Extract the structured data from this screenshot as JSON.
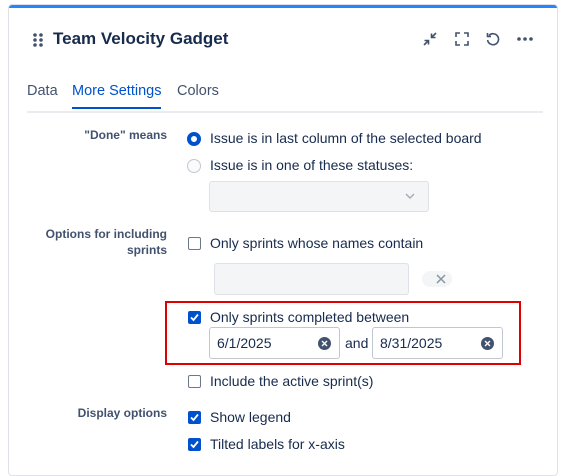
{
  "gadget": {
    "title": "Team Velocity Gadget"
  },
  "header_icons": [
    "drag-handle-icon",
    "minimize-icon",
    "fullscreen-icon",
    "refresh-icon",
    "more-icon"
  ],
  "tabs": [
    {
      "label": "Data",
      "active": false
    },
    {
      "label": "More Settings",
      "active": true
    },
    {
      "label": "Colors",
      "active": false
    }
  ],
  "done_means": {
    "label": "\"Done\" means",
    "options": [
      {
        "label": "Issue is in last column of the selected board",
        "selected": true
      },
      {
        "label": "Issue is in one of these statuses:",
        "selected": false
      }
    ],
    "status_select_value": ""
  },
  "sprints": {
    "label": "Options for including sprints",
    "name_contains": {
      "label": "Only sprints whose names contain",
      "checked": false,
      "value": ""
    },
    "completed_between": {
      "label": "Only sprints completed between",
      "checked": true,
      "start": "6/1/2025",
      "and_label": "and",
      "end": "8/31/2025"
    },
    "include_active": {
      "label": "Include the active sprint(s)",
      "checked": false
    }
  },
  "display": {
    "label": "Display options",
    "show_legend": {
      "label": "Show legend",
      "checked": true
    },
    "tilted_labels": {
      "label": "Tilted labels for x-axis",
      "checked": true
    }
  },
  "colors": {
    "accent": "#0052cc",
    "top_bar": "#2684ff",
    "highlight": "#e00000"
  }
}
